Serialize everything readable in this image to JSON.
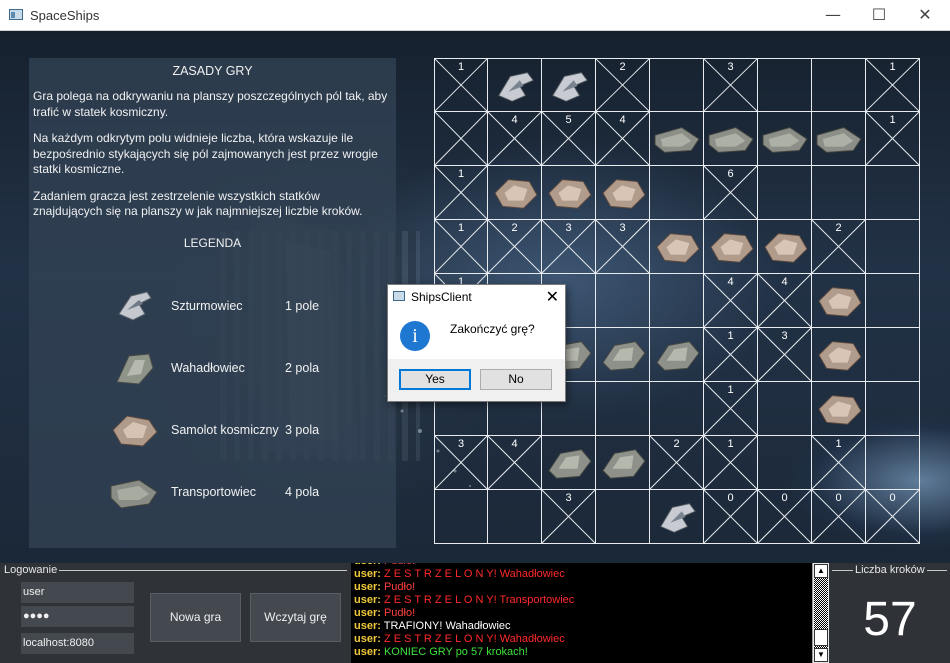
{
  "window": {
    "title": "SpaceShips",
    "minimize": "—",
    "maximize": "☐",
    "close": "✕"
  },
  "rules": {
    "heading": "ZASADY GRY",
    "paragraphs": [
      "Gra polega na odkrywaniu na planszy poszczególnych pól tak, aby trafić w statek kosmiczny.",
      "Na każdym odkrytym polu widnieje liczba, która wskazuje ile bezpośrednio stykających się pól zajmowanych jest przez wrogie statki kosmiczne.",
      "Zadaniem gracza jest zestrzelenie wszystkich statków znajdujących się na planszy w jak najmniejszej liczbie kroków."
    ],
    "legend_heading": "LEGENDA",
    "legend": [
      {
        "name": "Szturmowiec",
        "size": "1 pole",
        "icon": "fighter-ship-icon"
      },
      {
        "name": "Wahadłowiec",
        "size": "2 pola",
        "icon": "shuttle-ship-icon"
      },
      {
        "name": "Samolot kosmiczny",
        "size": "3 pola",
        "icon": "spaceplane-ship-icon"
      },
      {
        "name": "Transportowiec",
        "size": "4 pola",
        "icon": "transport-ship-icon"
      }
    ]
  },
  "board": {
    "rows": [
      [
        "X1",
        "S1",
        "S1",
        "X2",
        "",
        "X3",
        "",
        "",
        "X1"
      ],
      [
        "X",
        "X4",
        "X5",
        "X4",
        "S4",
        "S4",
        "S4",
        "S4",
        "X1"
      ],
      [
        "X1",
        "S3",
        "S3",
        "S3",
        "",
        "X6",
        "",
        "",
        ""
      ],
      [
        "X1",
        "X2",
        "X3",
        "X3",
        "S3",
        "S3",
        "S3",
        "X2",
        ""
      ],
      [
        "X1",
        "",
        "",
        "",
        "",
        "X4",
        "X4",
        "S3",
        ""
      ],
      [
        "",
        "",
        "S2",
        "S2",
        "S2",
        "X1",
        "X3",
        "S3",
        ""
      ],
      [
        "",
        "",
        "",
        "",
        "",
        "X1",
        "",
        "S3",
        ""
      ],
      [
        "X3",
        "X4",
        "S2",
        "S2",
        "X2",
        "X1",
        "",
        "X1",
        ""
      ],
      [
        "",
        "",
        "X3",
        "",
        "S1",
        "X0",
        "X0",
        "X0",
        "X0"
      ]
    ]
  },
  "login": {
    "group_title": "Logowanie",
    "user": "user",
    "password": "●●●●",
    "server": "localhost:8080",
    "new_game": "Nowa gra",
    "load_game": "Wczytaj grę"
  },
  "log": [
    {
      "user": "user:",
      "text": "Pudło!",
      "color": "#ff4040"
    },
    {
      "user": "user:",
      "text": "Z E S T R Z E L O N Y! Wahadłowiec",
      "color": "#ff2a2a"
    },
    {
      "user": "user:",
      "text": "Pudło!",
      "color": "#ff4040"
    },
    {
      "user": "user:",
      "text": "Z E S T R Z E L O N Y! Transportowiec",
      "color": "#ff2a2a"
    },
    {
      "user": "user:",
      "text": "Pudło!",
      "color": "#ff4040"
    },
    {
      "user": "user:",
      "text": "TRAFIONY! Wahadłowiec",
      "color": "#ffffff"
    },
    {
      "user": "user:",
      "text": "Z E S T R Z E L O N Y! Wahadłowiec",
      "color": "#ff2a2a"
    },
    {
      "user": "user:",
      "text": "KONIEC GRY po 57 krokach!",
      "color": "#3ee03e"
    }
  ],
  "steps": {
    "group_title": "Liczba kroków",
    "value": "57"
  },
  "dialog": {
    "title": "ShipsClient",
    "close": "✕",
    "message": "Zakończyć grę?",
    "icon": "info-icon",
    "yes": "Yes",
    "no": "No"
  }
}
